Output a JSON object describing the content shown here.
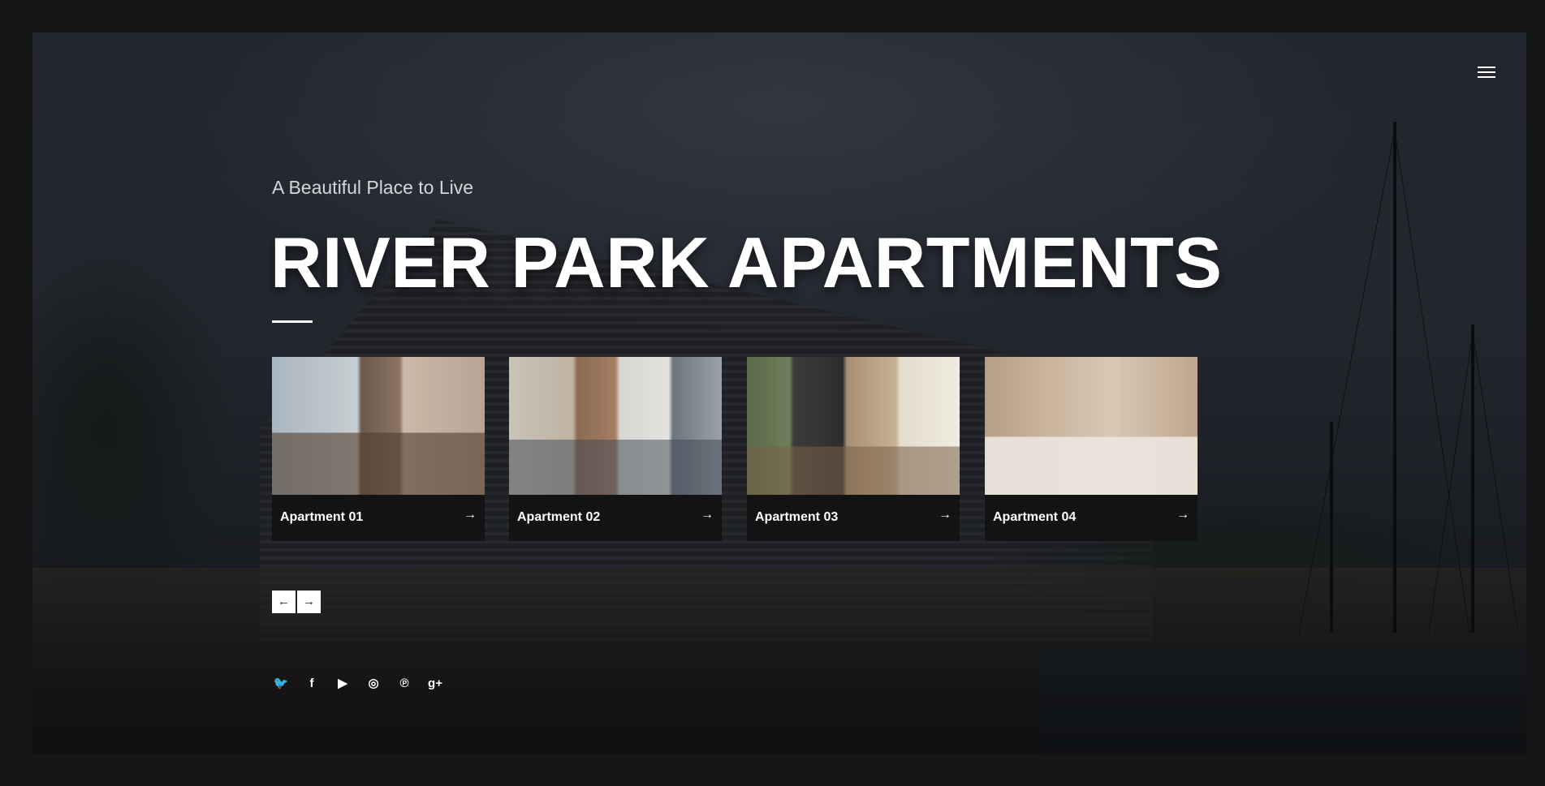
{
  "header": {
    "menu_icon": "hamburger-menu-icon"
  },
  "hero": {
    "subtitle": "A Beautiful Place to Live",
    "title": "RIVER PARK APARTMENTS"
  },
  "apartments": [
    {
      "label": "Apartment 01",
      "arrow": "→"
    },
    {
      "label": "Apartment 02",
      "arrow": "→"
    },
    {
      "label": "Apartment 03",
      "arrow": "→"
    },
    {
      "label": "Apartment 04",
      "arrow": "→"
    }
  ],
  "slider_nav": {
    "prev": "←",
    "next": "→"
  },
  "social": [
    {
      "icon": "twitter-icon",
      "glyph": "🐦"
    },
    {
      "icon": "facebook-icon",
      "glyph": "f"
    },
    {
      "icon": "youtube-icon",
      "glyph": "▶"
    },
    {
      "icon": "instagram-icon",
      "glyph": "◎"
    },
    {
      "icon": "pinterest-icon",
      "glyph": "℗"
    },
    {
      "icon": "google-plus-icon",
      "glyph": "g+"
    }
  ],
  "colors": {
    "page_border": "#161616",
    "text": "#ffffff",
    "card_bar": "#121214"
  }
}
